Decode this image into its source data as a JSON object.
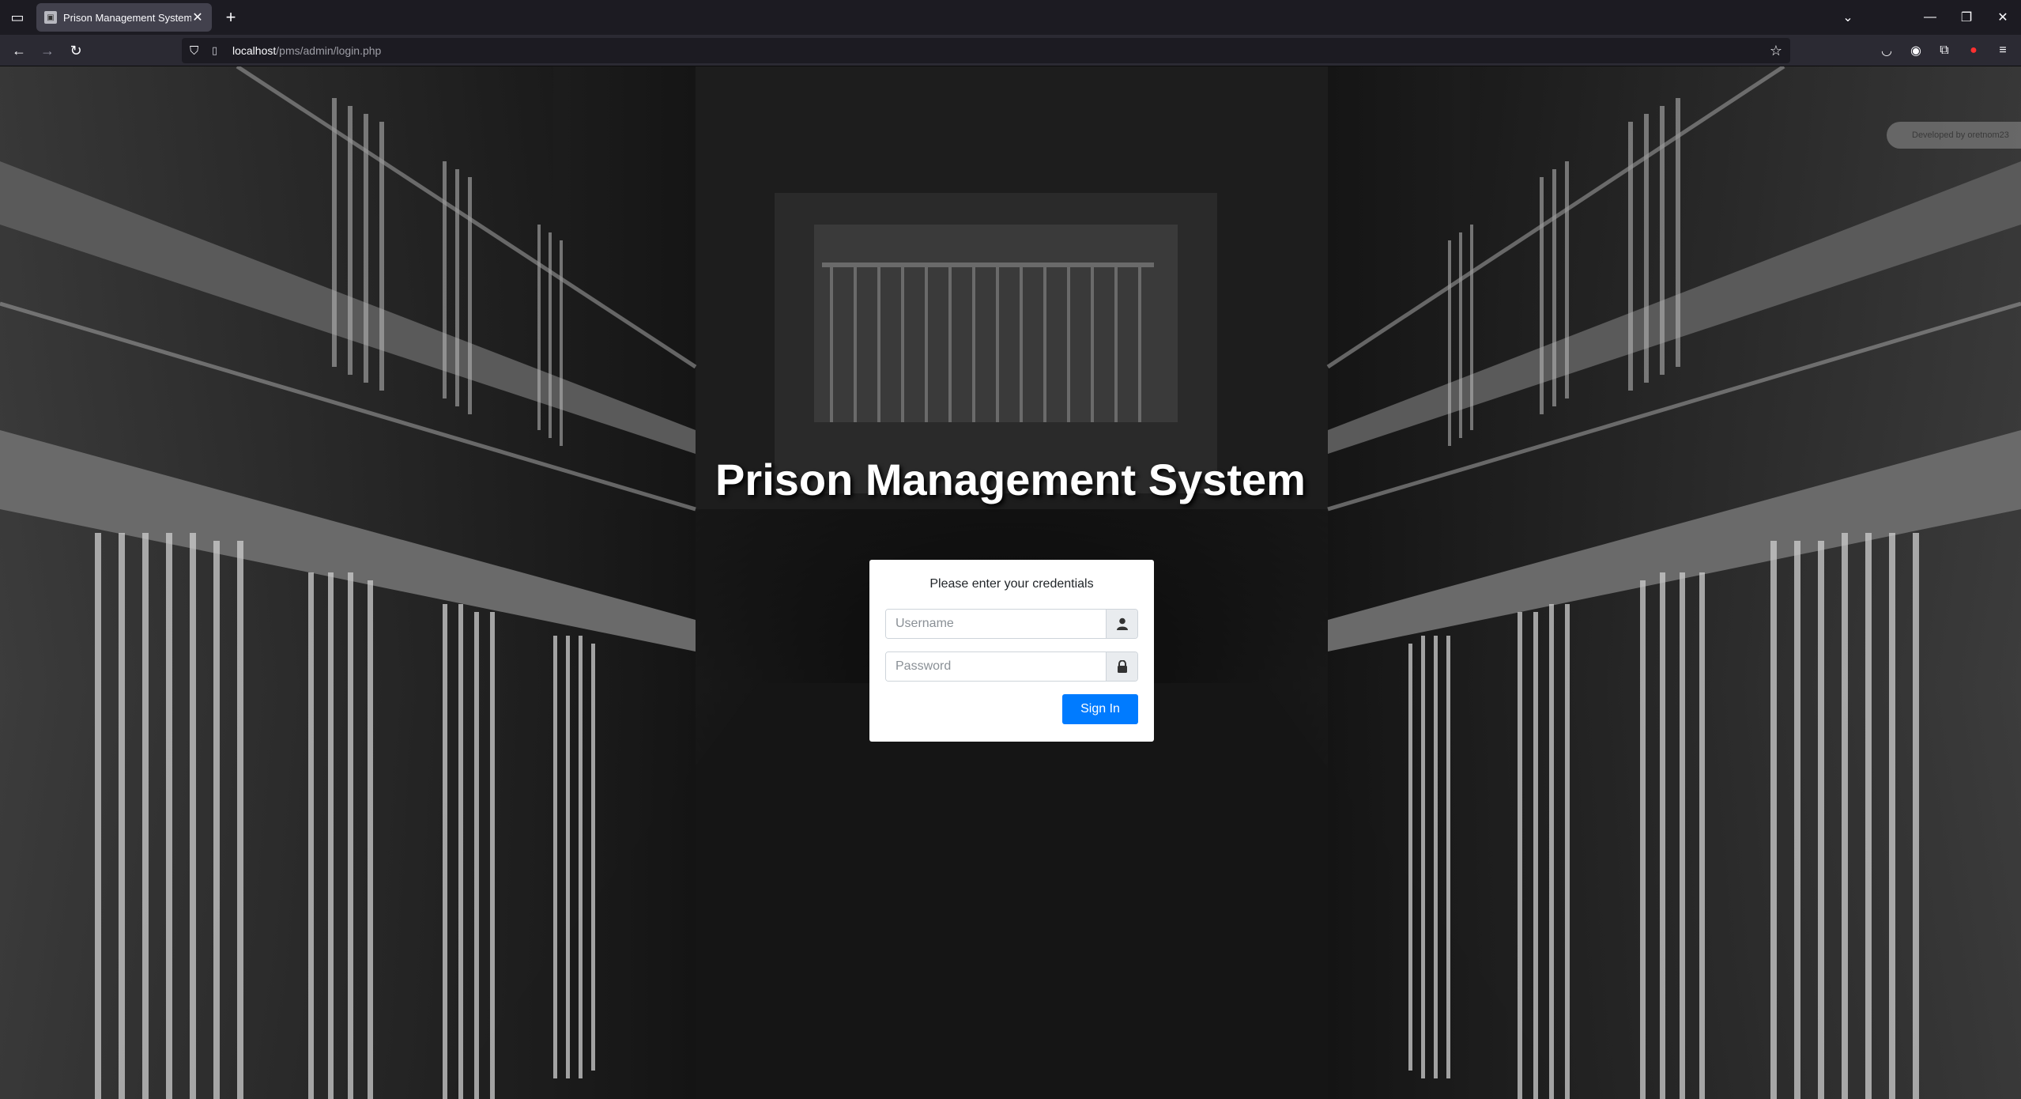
{
  "browser": {
    "tab_title": "Prison Management System",
    "url_host": "localhost",
    "url_path": "/pms/admin/login.php",
    "icons": {
      "tab_list": "tab-list-icon",
      "favicon": "favicon-icon",
      "tab_close": "close-icon",
      "new_tab": "plus-icon",
      "back": "arrow-left-icon",
      "forward": "arrow-right-icon",
      "reload": "reload-icon",
      "shield": "shield-icon",
      "bookmark": "star-icon",
      "pocket": "pocket-icon",
      "account": "account-icon",
      "extensions": "puzzle-icon",
      "extension_red": "record-icon",
      "menu": "hamburger-icon"
    }
  },
  "page": {
    "developer_badge": "Developed by oretnom23",
    "heading": "Prison Management System",
    "login": {
      "message": "Please enter your credentials",
      "username_placeholder": "Username",
      "password_placeholder": "Password",
      "submit_label": "Sign In"
    }
  },
  "colors": {
    "primary_button": "#007bff",
    "card_background": "#ffffff",
    "chrome_dark": "#1c1b22",
    "chrome_nav": "#2b2a33"
  }
}
